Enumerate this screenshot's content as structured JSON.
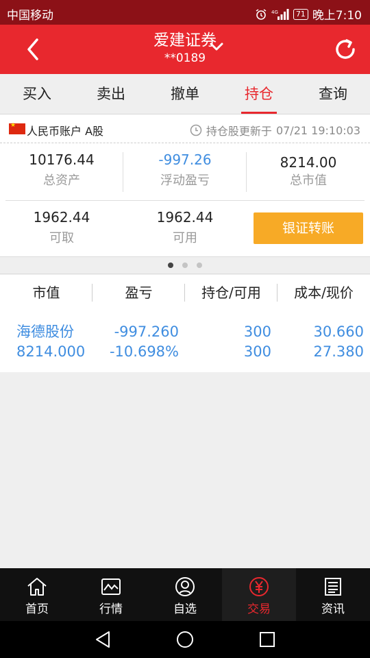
{
  "status": {
    "carrier": "中国移动",
    "battery": "71",
    "time": "晚上7:10"
  },
  "header": {
    "title": "爱建证券",
    "subtitle": "**0189"
  },
  "tabs": [
    {
      "label": "买入",
      "active": false
    },
    {
      "label": "卖出",
      "active": false
    },
    {
      "label": "撤单",
      "active": false
    },
    {
      "label": "持仓",
      "active": true
    },
    {
      "label": "查询",
      "active": false
    }
  ],
  "account": {
    "label": "人民币账户 A股",
    "update_prefix": "持仓股更新于",
    "update_time": "07/21 19:10:03"
  },
  "summary": {
    "total_assets": {
      "value": "10176.44",
      "label": "总资产"
    },
    "floating_pl": {
      "value": "-997.26",
      "label": "浮动盈亏"
    },
    "market_value": {
      "value": "8214.00",
      "label": "总市值"
    },
    "withdrawable": {
      "value": "1962.44",
      "label": "可取"
    },
    "available": {
      "value": "1962.44",
      "label": "可用"
    },
    "transfer_button": "银证转账"
  },
  "pager": {
    "pages": 3,
    "current": 1
  },
  "list_headers": [
    "市值",
    "盈亏",
    "持仓/可用",
    "成本/现价"
  ],
  "holdings": [
    {
      "name": "海德股份",
      "market_value": "8214.000",
      "pl": "-997.260",
      "pl_pct": "-10.698%",
      "position": "300",
      "available": "300",
      "cost": "30.660",
      "price": "27.380"
    }
  ],
  "bottom_nav": [
    {
      "label": "首页",
      "icon": "home-icon"
    },
    {
      "label": "行情",
      "icon": "chart-icon"
    },
    {
      "label": "自选",
      "icon": "user-icon"
    },
    {
      "label": "交易",
      "icon": "yuan-icon",
      "active": true
    },
    {
      "label": "资讯",
      "icon": "news-icon"
    }
  ],
  "colors": {
    "brand_red": "#e8282e",
    "status_red": "#8c1117",
    "accent_orange": "#f7aa26",
    "value_blue": "#3f8de0"
  }
}
